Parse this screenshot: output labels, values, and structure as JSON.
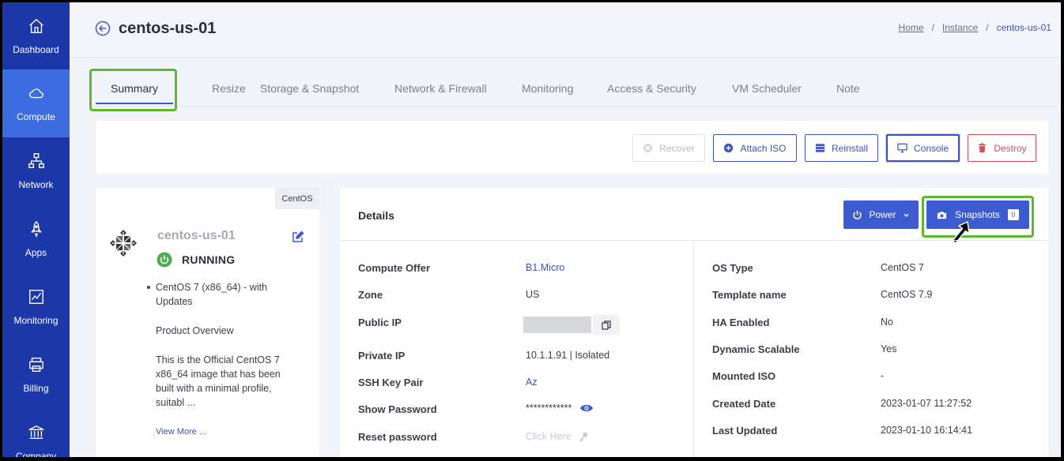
{
  "sidebar": {
    "items": [
      {
        "label": "Dashboard",
        "icon": "home-icon"
      },
      {
        "label": "Compute",
        "icon": "cloud-icon",
        "active": true
      },
      {
        "label": "Network",
        "icon": "network-icon"
      },
      {
        "label": "Apps",
        "icon": "rocket-icon"
      },
      {
        "label": "Monitoring",
        "icon": "chart-icon"
      },
      {
        "label": "Billing",
        "icon": "printer-icon"
      },
      {
        "label": "Company",
        "icon": "bank-icon"
      }
    ]
  },
  "header": {
    "title": "centos-us-01",
    "breadcrumb": {
      "home": "Home",
      "sep": "/",
      "instance": "Instance",
      "current": "centos-us-01"
    }
  },
  "tabs": [
    {
      "label": "Summary",
      "active": true
    },
    {
      "label": "Resize"
    },
    {
      "label": "Storage & Snapshot"
    },
    {
      "label": "Network & Firewall"
    },
    {
      "label": "Monitoring"
    },
    {
      "label": "Access & Security"
    },
    {
      "label": "VM Scheduler"
    },
    {
      "label": "Note"
    }
  ],
  "actions": {
    "recover": "Recover",
    "attach_iso": "Attach ISO",
    "reinstall": "Reinstall",
    "console": "Console",
    "destroy": "Destroy"
  },
  "instance_card": {
    "os_badge": "CentOS",
    "name": "centos-us-01",
    "status": "RUNNING",
    "bullet": "CentOS 7 (x86_64) - with Updates",
    "overview_heading": "Product Overview",
    "overview_text": "This is the Official CentOS 7 x86_64 image that has been built with a minimal profile, suitabl ...",
    "view_more": "View More ..."
  },
  "details": {
    "title": "Details",
    "power_label": "Power",
    "snapshots_label": "Snapshots",
    "snapshots_count": "0",
    "left": [
      {
        "label": "Compute Offer",
        "value": "B1.Micro",
        "link": true
      },
      {
        "label": "Zone",
        "value": "US"
      },
      {
        "label": "Public IP",
        "value": ""
      },
      {
        "label": "Private IP",
        "value": "10.1.1.91 | Isolated"
      },
      {
        "label": "SSH Key Pair",
        "value": "Az",
        "link": true
      },
      {
        "label": "Show Password",
        "value": "************"
      },
      {
        "label": "Reset password",
        "value": "Click Here"
      }
    ],
    "right": [
      {
        "label": "OS Type",
        "value": "CentOS 7"
      },
      {
        "label": "Template name",
        "value": "CentOS 7.9"
      },
      {
        "label": "HA Enabled",
        "value": "No"
      },
      {
        "label": "Dynamic Scalable",
        "value": "Yes"
      },
      {
        "label": "Mounted ISO",
        "value": "-"
      },
      {
        "label": "Created Date",
        "value": "2023-01-07 11:27:52"
      },
      {
        "label": "Last Updated",
        "value": "2023-01-10 16:14:41"
      }
    ]
  },
  "colors": {
    "sidebar_bg": "#1c38a8",
    "sidebar_active": "#3d6be0",
    "accent": "#3d5bd0",
    "highlight": "#5cb82e",
    "danger": "#d6505b",
    "running": "#4cae4c"
  }
}
